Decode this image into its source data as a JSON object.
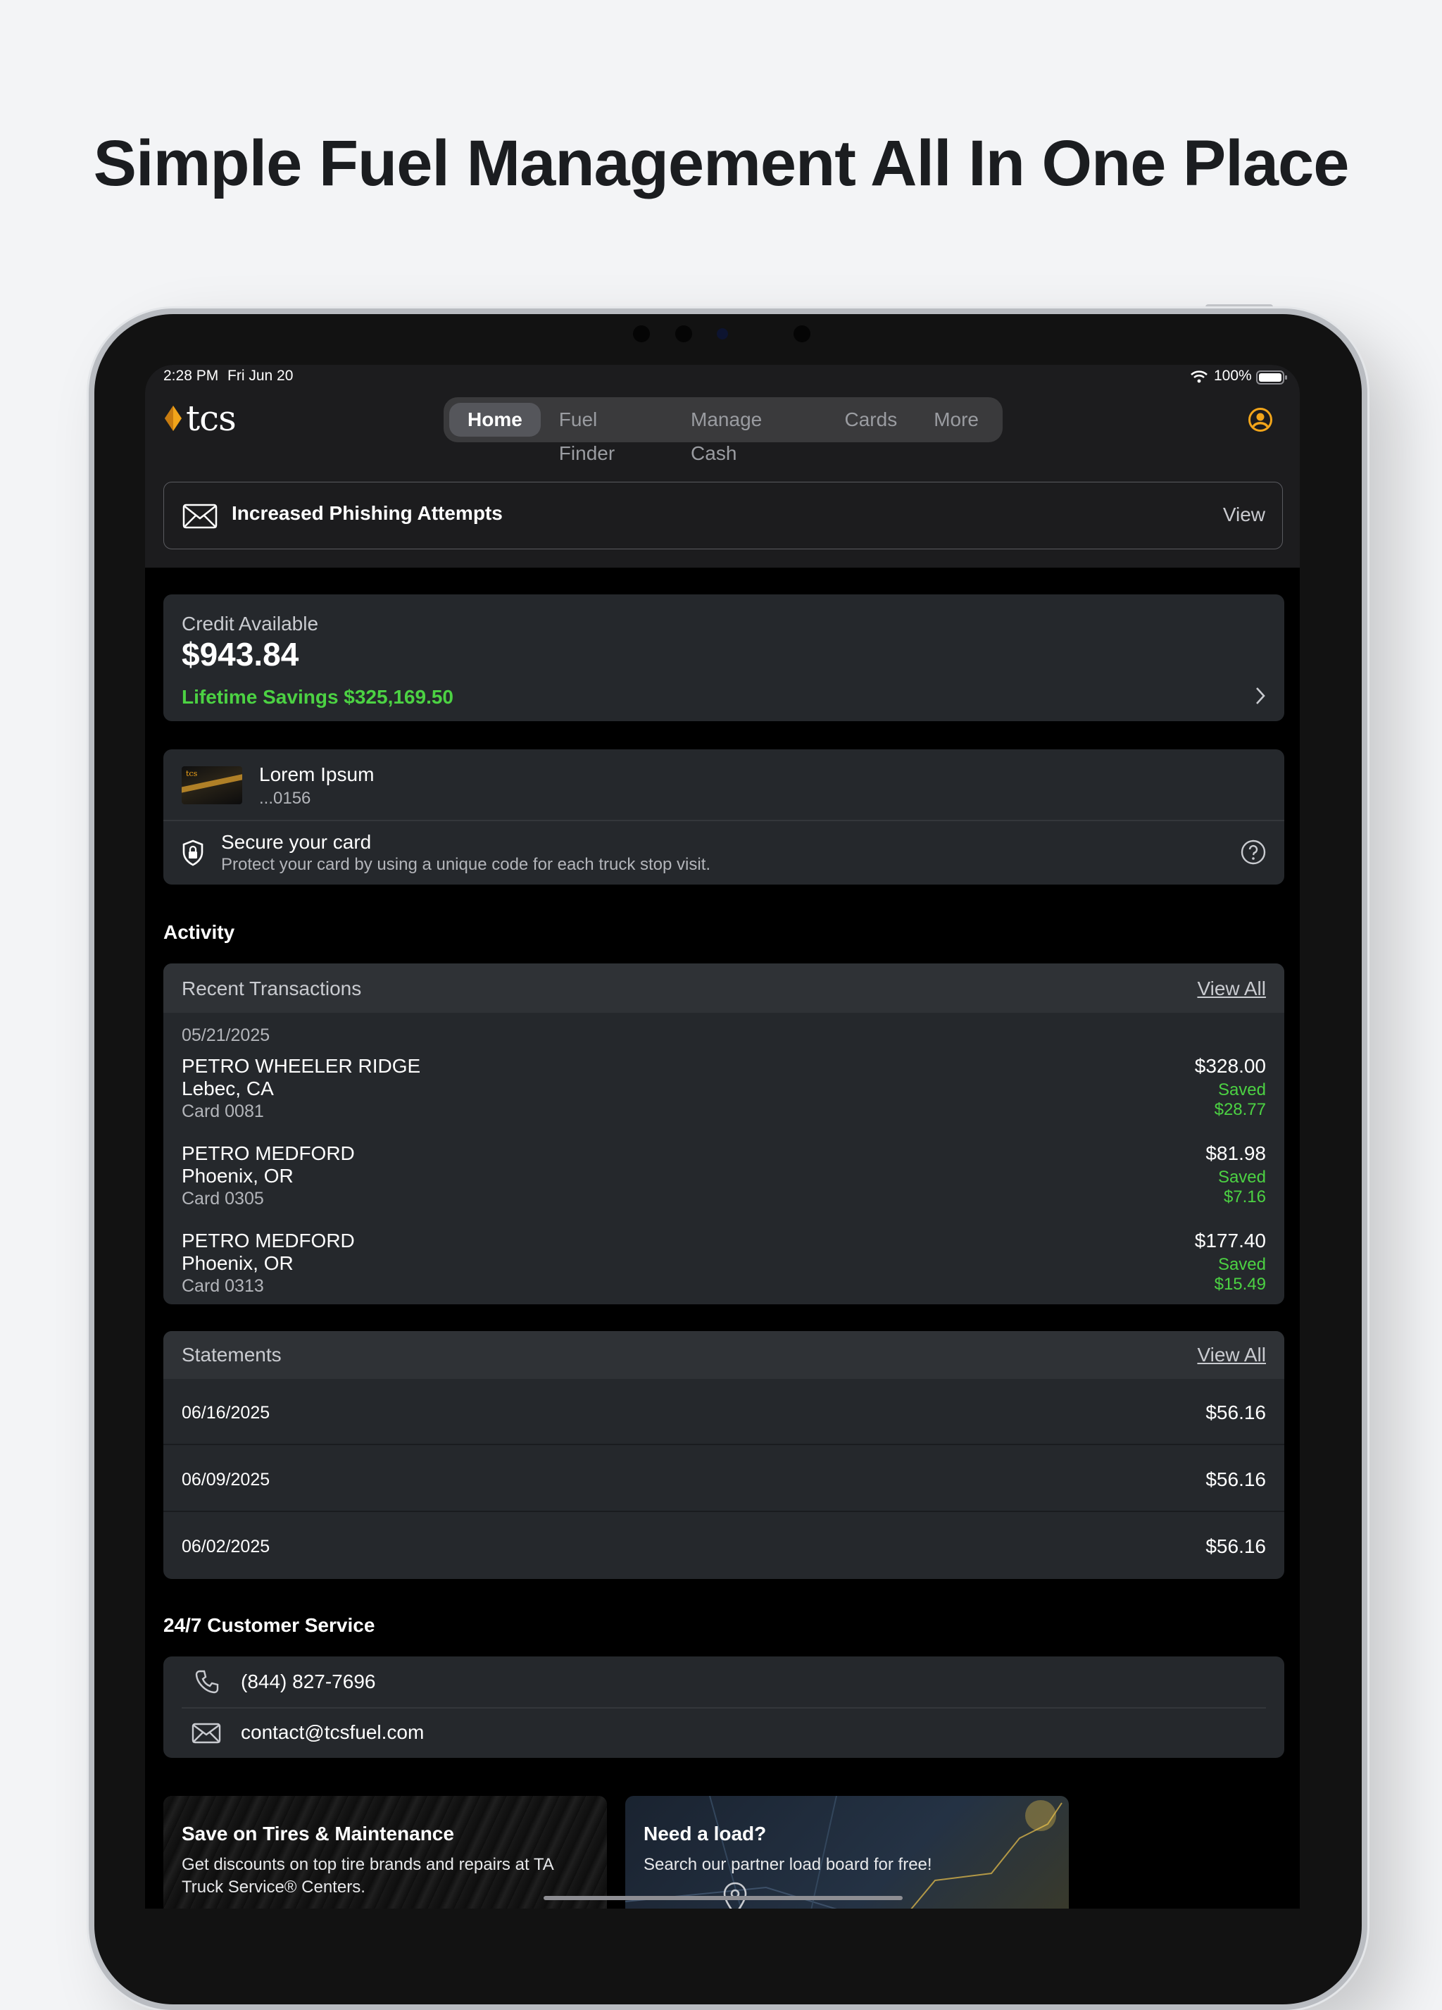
{
  "headline": "Simple Fuel Management All In One Place",
  "status_bar": {
    "time": "2:28 PM",
    "date": "Fri Jun 20",
    "battery": "100%"
  },
  "logo_text": "tcs",
  "nav": {
    "tabs": [
      "Home",
      "Fuel Finder",
      "Manage Cash",
      "Cards",
      "More"
    ],
    "active": "Home"
  },
  "alert": {
    "text": "Increased Phishing Attempts",
    "action": "View"
  },
  "credit": {
    "label": "Credit Available",
    "amount": "$943.84",
    "savings": "Lifetime Savings $325,169.50"
  },
  "card_info": {
    "name": "Lorem Ipsum",
    "number": "...0156",
    "secure_title": "Secure your card",
    "secure_desc": "Protect your card by using a unique code for each truck stop visit.",
    "card_logo": "tcs"
  },
  "activity": {
    "title": "Activity",
    "recent": {
      "title": "Recent Transactions",
      "view_all": "View All",
      "date": "05/21/2025",
      "items": [
        {
          "name": "PETRO WHEELER RIDGE",
          "location": "Lebec, CA",
          "card": "Card 0081",
          "amount": "$328.00",
          "saved_label": "Saved",
          "saved": "$28.77"
        },
        {
          "name": "PETRO MEDFORD",
          "location": "Phoenix, OR",
          "card": "Card 0305",
          "amount": "$81.98",
          "saved_label": "Saved",
          "saved": "$7.16"
        },
        {
          "name": "PETRO MEDFORD",
          "location": "Phoenix, OR",
          "card": "Card 0313",
          "amount": "$177.40",
          "saved_label": "Saved",
          "saved": "$15.49"
        }
      ]
    },
    "statements": {
      "title": "Statements",
      "view_all": "View All",
      "items": [
        {
          "date": "06/16/2025",
          "amount": "$56.16"
        },
        {
          "date": "06/09/2025",
          "amount": "$56.16"
        },
        {
          "date": "06/02/2025",
          "amount": "$56.16"
        }
      ]
    }
  },
  "service": {
    "title": "24/7 Customer Service",
    "phone": "(844) 827-7696",
    "email": "contact@tcsfuel.com"
  },
  "promos": [
    {
      "title": "Save on Tires & Maintenance",
      "desc": "Get discounts on top tire brands and repairs at TA Truck Service® Centers."
    },
    {
      "title": "Need a load?",
      "desc": "Search our partner load board for free!"
    }
  ],
  "colors": {
    "accent_green": "#4cd243",
    "brand_gold": "#f2a51a",
    "screen_bg": "#000000",
    "card_bg": "#25282c"
  },
  "icons": [
    "wifi-icon",
    "battery-icon",
    "profile-icon",
    "envelope-icon",
    "chevron-right-icon",
    "shield-lock-icon",
    "help-icon",
    "phone-icon",
    "email-icon",
    "map-pin-icon"
  ]
}
